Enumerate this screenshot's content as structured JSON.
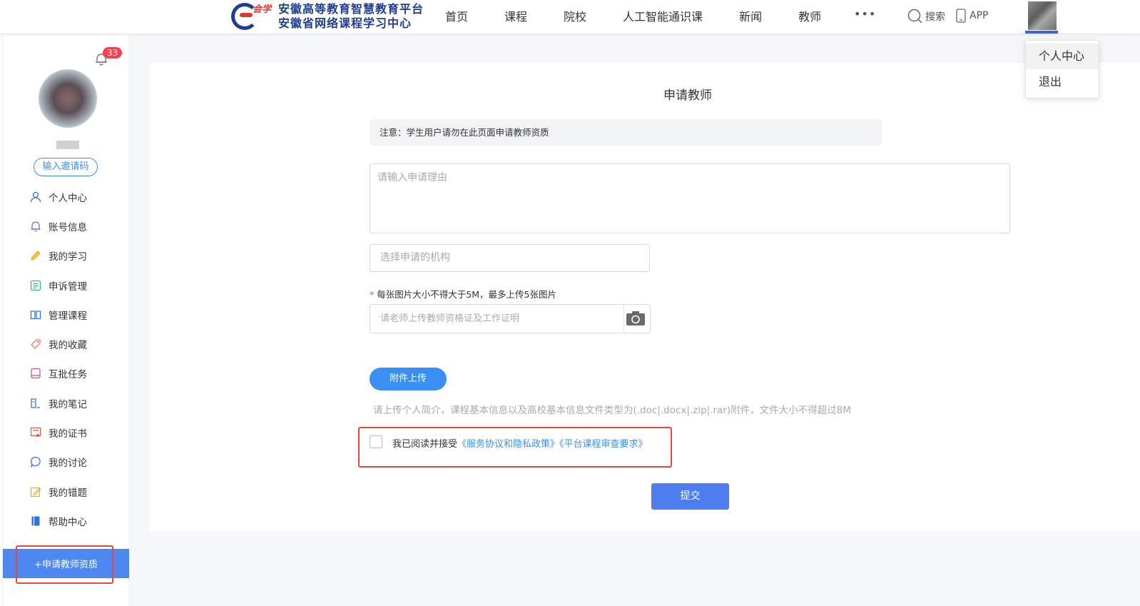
{
  "header": {
    "logo_script": "会学",
    "logo_line1": "安徽高等教育智慧教育平台",
    "logo_line2": "安徽省网络课程学习中心",
    "nav": [
      "首页",
      "课程",
      "院校",
      "人工智能通识课",
      "新闻",
      "教师"
    ],
    "more": "•••",
    "search_label": "搜索",
    "app_label": "APP",
    "accent_color": "#3d63dd"
  },
  "dropdown": {
    "items": [
      "个人中心",
      "退出"
    ]
  },
  "sidebar": {
    "notification_count": "33",
    "invite_label": "输入邀请码",
    "menu": [
      {
        "label": "个人中心",
        "icon": "user-icon"
      },
      {
        "label": "账号信息",
        "icon": "bell-icon"
      },
      {
        "label": "我的学习",
        "icon": "pencil-icon"
      },
      {
        "label": "申诉管理",
        "icon": "list-icon"
      },
      {
        "label": "管理课程",
        "icon": "book-icon"
      },
      {
        "label": "我的收藏",
        "icon": "tag-icon"
      },
      {
        "label": "互批任务",
        "icon": "tablet-icon"
      },
      {
        "label": "我的笔记",
        "icon": "note-icon"
      },
      {
        "label": "我的证书",
        "icon": "certificate-icon"
      },
      {
        "label": "我的讨论",
        "icon": "chat-icon"
      },
      {
        "label": "我的错题",
        "icon": "edit-icon"
      },
      {
        "label": "帮助中心",
        "icon": "help-book-icon"
      }
    ],
    "apply_label": "+申请教师资质"
  },
  "form": {
    "title": "申请教师",
    "notice": "注意：学生用户请勿在此页面申请教师资质",
    "reason_placeholder": "请输入申请理由",
    "org_placeholder": "选择申请的机构",
    "upload_note": "每张图片大小不得大于5M，最多上传5张图片",
    "upload_placeholder": "请老师上传教师资格证及工作证明",
    "attach_label": "附件上传",
    "attach_hint": "请上传个人简介，课程基本信息以及高校基本信息文件类型为(.doc|.docx|.zip|.rar)附件，文件大小不得超过8M",
    "agree_prefix": "我已阅读并接受",
    "agree_link1": "《服务协议和隐私政策》",
    "agree_link2": "《平台课程审查要求》",
    "submit_label": "提交"
  }
}
